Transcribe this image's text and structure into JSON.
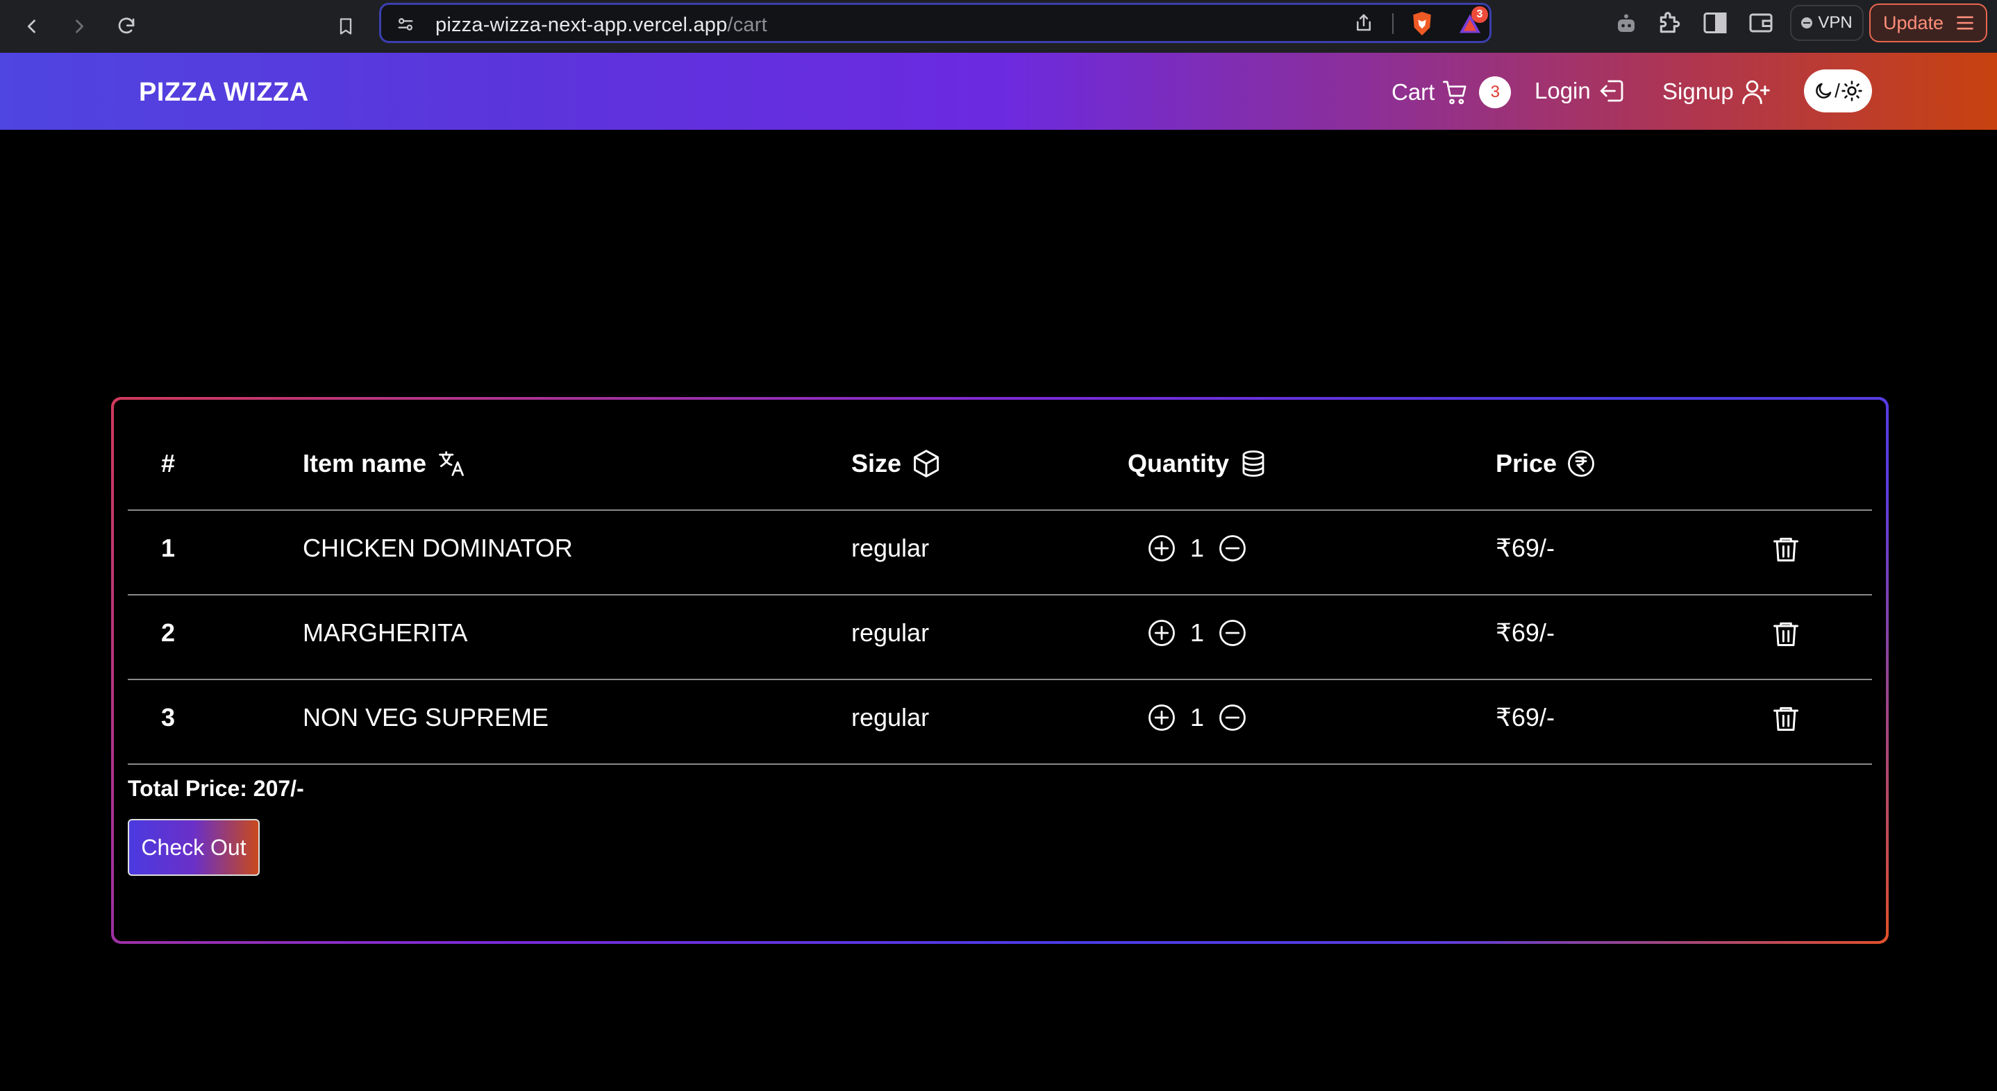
{
  "browser": {
    "url_host": "pizza-wizza-next-app.vercel.app",
    "url_path": "/cart",
    "extension_badge": "3",
    "vpn_label": "VPN",
    "update_label": "Update"
  },
  "header": {
    "brand": "PIZZA WIZZA",
    "cart_label": "Cart",
    "cart_count": "3",
    "login_label": "Login",
    "signup_label": "Signup",
    "theme_toggle_separator": "/"
  },
  "table": {
    "headers": {
      "index": "#",
      "item_name": "Item name",
      "size": "Size",
      "quantity": "Quantity",
      "price": "Price"
    },
    "rows": [
      {
        "index": "1",
        "name": "CHICKEN DOMINATOR",
        "size": "regular",
        "quantity": "1",
        "price": "₹69/-"
      },
      {
        "index": "2",
        "name": "MARGHERITA",
        "size": "regular",
        "quantity": "1",
        "price": "₹69/-"
      },
      {
        "index": "3",
        "name": "NON VEG SUPREME",
        "size": "regular",
        "quantity": "1",
        "price": "₹69/-"
      }
    ]
  },
  "summary": {
    "total_label": "Total Price: 207/-",
    "checkout_label": "Check Out"
  },
  "colors": {
    "header_gradient_start": "#4f45e0",
    "header_gradient_mid": "#6c2ae0",
    "header_gradient_end": "#c8420f",
    "cart_badge_text": "#e0382e",
    "page_background": "#000000"
  }
}
